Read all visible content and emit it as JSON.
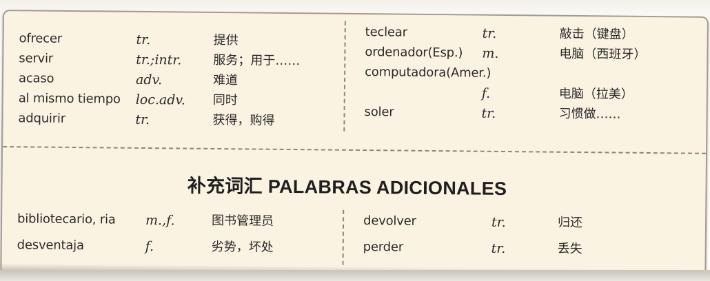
{
  "top_left_entries": [
    {
      "word": "ofrecer",
      "pos": "tr.",
      "meaning": "提供"
    },
    {
      "word": "servir",
      "pos": "tr.;intr.",
      "meaning": "服务；用于……"
    },
    {
      "word": "acaso",
      "pos": "adv.",
      "meaning": "难道"
    },
    {
      "word": "al mismo tiempo",
      "pos": "loc.adv.",
      "meaning": "同时"
    },
    {
      "word": "adquirir",
      "pos": "tr.",
      "meaning": "获得，购得"
    }
  ],
  "top_right_entries": [
    {
      "word": "teclear",
      "pos": "tr.",
      "meaning": "敲击（键盘）"
    },
    {
      "word": "ordenador(Esp.)",
      "pos": "m.",
      "meaning": "电脑（西班牙）"
    },
    {
      "word": "computadora(Amer.)",
      "pos": "",
      "meaning": ""
    },
    {
      "word": "",
      "pos": "f.",
      "meaning": "电脑（拉美）"
    },
    {
      "word": "soler",
      "pos": "tr.",
      "meaning": "习惯做……"
    }
  ],
  "section_title": "补充词汇 PALABRAS ADICIONALES",
  "bottom_left_entries": [
    {
      "word": "bibliotecario, ria",
      "pos": "m.,f.",
      "meaning": "图书管理员"
    },
    {
      "word": "desventaja",
      "pos": "f.",
      "meaning": "劣势，坏处"
    }
  ],
  "bottom_right_entries": [
    {
      "word": "devolver",
      "pos": "tr.",
      "meaning": "归还"
    },
    {
      "word": "perder",
      "pos": "tr.",
      "meaning": "丢失"
    }
  ],
  "colors": {
    "box_background": "#fbf3e2",
    "divider": "#8c8579",
    "text": "#2a2a2a"
  }
}
